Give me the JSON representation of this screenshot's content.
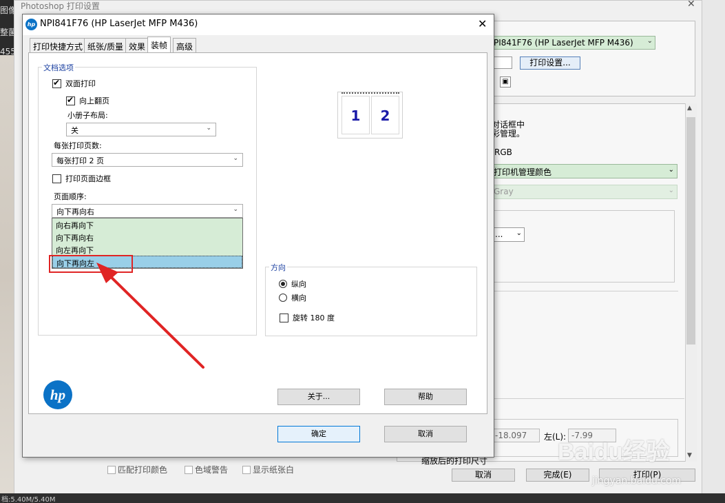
{
  "background_app": {
    "title": "Photoshop 打印设置",
    "left_menu": [
      "图像",
      "整菌",
      "455"
    ],
    "printer_select": "PI841F76 (HP LaserJet MFP M436)",
    "print_settings_button": "打印设置...",
    "color_text_line1": "对话框中",
    "color_text_line2": "彩管理。",
    "color_profile_text": "RGB",
    "color_handling_select": "打印机管理颜色",
    "gray_select": "Gray",
    "small_select": "...",
    "top_value": "-18.097",
    "left_label": "左(L):",
    "left_value": "-7.99",
    "scaled_size_label": "缩放后的打印尺寸",
    "checkbox_match": "匹配打印颜色",
    "checkbox_gamut": "色域警告",
    "checkbox_paper": "显示纸张白",
    "cancel_button": "取消",
    "done_button": "完成(E)",
    "print_button": "打印(P)",
    "status_text": "档:5.40M/5.40M"
  },
  "watermark": {
    "text": "Baidu经验",
    "sub": "jingyan.baidu.com"
  },
  "dialog": {
    "title": "NPI841F76 (HP LaserJet MFP M436)",
    "logo_small": "hp",
    "tabs": [
      {
        "label": "打印快捷方式",
        "active": false
      },
      {
        "label": "纸张/质量",
        "active": false
      },
      {
        "label": "效果",
        "active": false
      },
      {
        "label": "装帧",
        "active": true
      },
      {
        "label": "高级",
        "active": false
      }
    ],
    "document_options": {
      "group_label": "文档选项",
      "duplex_label": "双面打印",
      "duplex_checked": true,
      "flip_up_label": "向上翻页",
      "flip_up_checked": true,
      "booklet_label": "小册子布局:",
      "booklet_value": "关",
      "pages_per_sheet_label": "每张打印页数:",
      "pages_per_sheet_value": "每张打印 2 页",
      "borders_label": "打印页面边框",
      "borders_checked": false,
      "page_order_label": "页面顺序:",
      "page_order_value": "向下再向右",
      "page_order_options": [
        "向右再向下",
        "向下再向右",
        "向左再向下",
        "向下再向左"
      ],
      "highlighted_option": "向下再向左"
    },
    "preview": {
      "page1": "1",
      "page2": "2"
    },
    "orientation": {
      "group_label": "方向",
      "portrait_label": "纵向",
      "portrait_selected": true,
      "landscape_label": "横向",
      "rotate_label": "旋转 180 度",
      "rotate_checked": false
    },
    "hp_logo": "hp",
    "buttons": {
      "about": "关于...",
      "help": "帮助",
      "ok": "确定",
      "cancel": "取消"
    }
  },
  "colors": {
    "annotation_red": "#e02424",
    "option_green": "#d6ecd6",
    "option_selected_blue": "#99cfe8",
    "hp_blue": "#0b72c6",
    "group_label_blue": "#1a3fa0"
  },
  "icons": [
    "close-icon",
    "dropdown-arrow-icon",
    "checkmark-icon",
    "hp-logo-icon",
    "annotation-arrow-icon"
  ]
}
